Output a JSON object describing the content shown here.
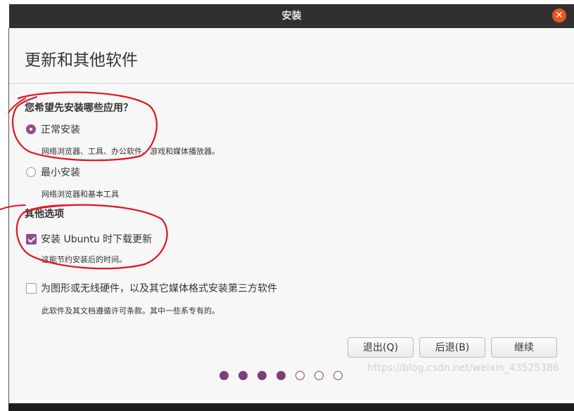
{
  "window": {
    "title": "安装",
    "close_icon": "close-icon"
  },
  "page": {
    "title": "更新和其他软件"
  },
  "apps_section": {
    "title": "您希望先安装哪些应用？",
    "options": [
      {
        "label": "正常安装",
        "desc": "网络浏览器、工具、办公软件、游戏和媒体播放器。",
        "selected": true
      },
      {
        "label": "最小安装",
        "desc": "网络浏览器和基本工具",
        "selected": false
      }
    ]
  },
  "other_section": {
    "title": "其他选项",
    "options": [
      {
        "label": "安装 Ubuntu 时下载更新",
        "desc": "这能节约安装后的时间。",
        "checked": true
      },
      {
        "label": "为图形或无线硬件，以及其它媒体格式安装第三方软件",
        "desc": "此软件及其文档遵循许可条款。其中一些系专有的。",
        "checked": false
      }
    ]
  },
  "buttons": {
    "quit": "退出(Q)",
    "back": "后退(B)",
    "continue": "继续"
  },
  "progress": {
    "steps_total": 7,
    "steps_done": 4
  },
  "watermark": "https://blog.csdn.net/weixin_43525386",
  "colors": {
    "accent": "#924d8b",
    "close": "#e95420",
    "titlebar": "#303030",
    "annotation": "#e0141e"
  }
}
